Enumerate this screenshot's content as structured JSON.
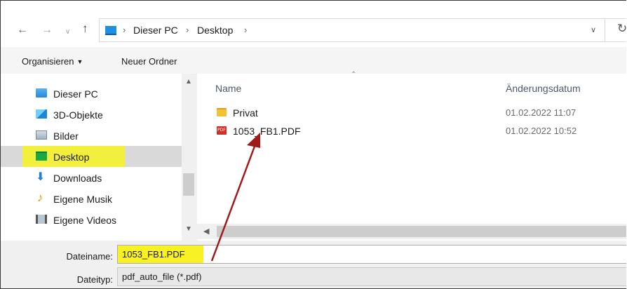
{
  "breadcrumb": {
    "segments": [
      "Dieser PC",
      "Desktop"
    ]
  },
  "toolbar": {
    "organize_label": "Organisieren",
    "new_folder_label": "Neuer Ordner"
  },
  "nav": {
    "items": [
      {
        "label": "Dieser PC",
        "icon": "this-pc-icon"
      },
      {
        "label": "3D-Objekte",
        "icon": "3d-objects-icon"
      },
      {
        "label": "Bilder",
        "icon": "pictures-icon"
      },
      {
        "label": "Desktop",
        "icon": "desktop-icon",
        "selected": true,
        "highlight": "#f7f321"
      },
      {
        "label": "Downloads",
        "icon": "downloads-icon"
      },
      {
        "label": "Eigene Musik",
        "icon": "music-icon"
      },
      {
        "label": "Eigene Videos",
        "icon": "videos-icon"
      }
    ]
  },
  "files": {
    "columns": {
      "name": "Name",
      "date": "Änderungsdatum"
    },
    "rows": [
      {
        "name": "Privat",
        "date": "01.02.2022 11:07",
        "type": "folder"
      },
      {
        "name": "1053_FB1.PDF",
        "date": "01.02.2022 10:52",
        "type": "pdf"
      }
    ]
  },
  "fields": {
    "filename_label": "Dateiname:",
    "filename_value": "1053_FB1.PDF",
    "filetype_label": "Dateityp:",
    "filetype_value": "pdf_auto_file (*.pdf)"
  },
  "colors": {
    "highlight": "#f7f321",
    "annotation_arrow": "#a01a1a"
  }
}
